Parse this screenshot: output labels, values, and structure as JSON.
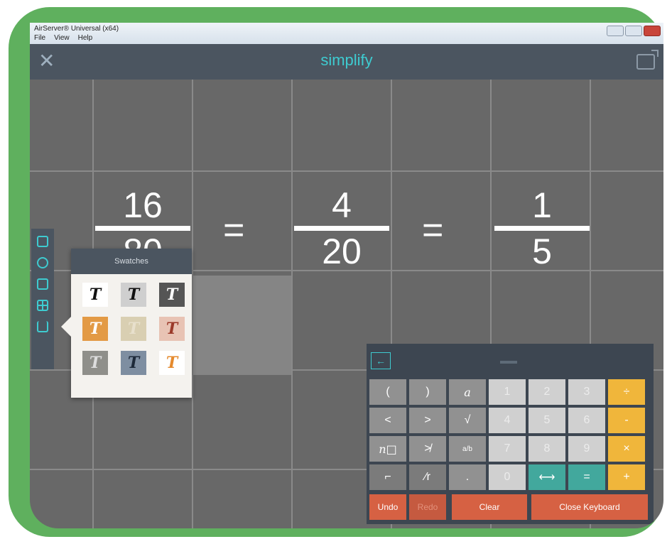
{
  "window": {
    "title": "AirServer® Universal (x64)",
    "menu": [
      "File",
      "View",
      "Help"
    ]
  },
  "app": {
    "title": "simplify",
    "close_glyph": "✕"
  },
  "equation": {
    "f1": {
      "num": "16",
      "den": "80"
    },
    "eq1": "=",
    "f2": {
      "num": "4",
      "den": "20"
    },
    "eq2": "=",
    "f3": {
      "num": "1",
      "den": "5"
    }
  },
  "swatches": {
    "title": "Swatches",
    "items": [
      {
        "glyph": "T",
        "bg": "#ffffff",
        "fg": "#111111"
      },
      {
        "glyph": "T",
        "bg": "#cfcfcf",
        "fg": "#111111"
      },
      {
        "glyph": "T",
        "bg": "#555555",
        "fg": "#ffffff"
      },
      {
        "glyph": "T",
        "bg": "#e39a45",
        "fg": "#ffffff"
      },
      {
        "glyph": "T",
        "bg": "#d9cfb2",
        "fg": "#e8e0cc"
      },
      {
        "glyph": "T",
        "bg": "#e8c3b4",
        "fg": "#9b3a2a"
      },
      {
        "glyph": "T",
        "bg": "#8f8f8a",
        "fg": "#dddddd"
      },
      {
        "glyph": "T",
        "bg": "#7e8ea1",
        "fg": "#1e2a3a"
      },
      {
        "glyph": "T",
        "bg": "#ffffff",
        "fg": "#e58a2e"
      }
    ]
  },
  "sidebar": {
    "icons": [
      "pages-icon",
      "style-icon",
      "notes-icon",
      "grid-icon",
      "share-icon"
    ]
  },
  "keyboard": {
    "back": "←",
    "rows": [
      [
        "(",
        ")",
        "a",
        "1",
        "2",
        "3",
        "÷"
      ],
      [
        "<",
        ">",
        "√",
        "4",
        "5",
        "6",
        "-"
      ],
      [
        "n□",
        "≯",
        "a/b",
        "7",
        "8",
        "9",
        "×"
      ],
      [
        "⌐",
        "⁄r",
        ".",
        "0",
        "⟷",
        "=",
        "+"
      ]
    ],
    "bottom": {
      "undo": "Undo",
      "redo": "Redo",
      "clear": "Clear",
      "close": "Close Keyboard"
    }
  }
}
